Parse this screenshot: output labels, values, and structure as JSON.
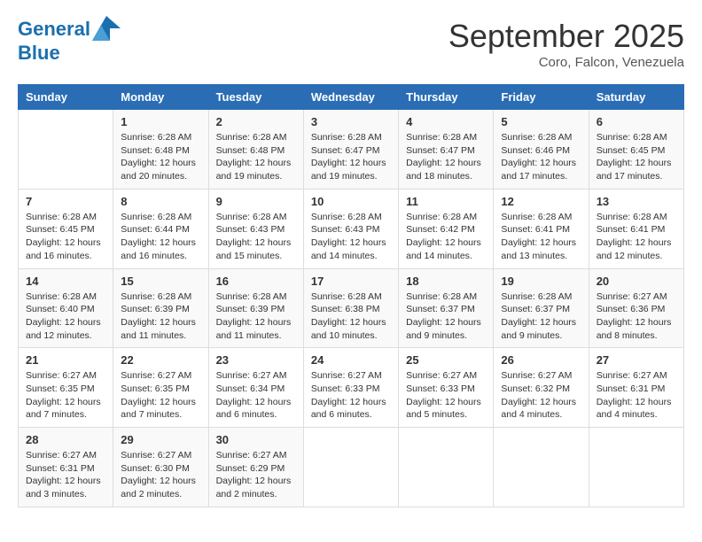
{
  "header": {
    "logo_line1": "General",
    "logo_line2": "Blue",
    "month": "September 2025",
    "location": "Coro, Falcon, Venezuela"
  },
  "columns": [
    "Sunday",
    "Monday",
    "Tuesday",
    "Wednesday",
    "Thursday",
    "Friday",
    "Saturday"
  ],
  "weeks": [
    [
      {
        "day": "",
        "text": ""
      },
      {
        "day": "1",
        "text": "Sunrise: 6:28 AM\nSunset: 6:48 PM\nDaylight: 12 hours\nand 20 minutes."
      },
      {
        "day": "2",
        "text": "Sunrise: 6:28 AM\nSunset: 6:48 PM\nDaylight: 12 hours\nand 19 minutes."
      },
      {
        "day": "3",
        "text": "Sunrise: 6:28 AM\nSunset: 6:47 PM\nDaylight: 12 hours\nand 19 minutes."
      },
      {
        "day": "4",
        "text": "Sunrise: 6:28 AM\nSunset: 6:47 PM\nDaylight: 12 hours\nand 18 minutes."
      },
      {
        "day": "5",
        "text": "Sunrise: 6:28 AM\nSunset: 6:46 PM\nDaylight: 12 hours\nand 17 minutes."
      },
      {
        "day": "6",
        "text": "Sunrise: 6:28 AM\nSunset: 6:45 PM\nDaylight: 12 hours\nand 17 minutes."
      }
    ],
    [
      {
        "day": "7",
        "text": "Sunrise: 6:28 AM\nSunset: 6:45 PM\nDaylight: 12 hours\nand 16 minutes."
      },
      {
        "day": "8",
        "text": "Sunrise: 6:28 AM\nSunset: 6:44 PM\nDaylight: 12 hours\nand 16 minutes."
      },
      {
        "day": "9",
        "text": "Sunrise: 6:28 AM\nSunset: 6:43 PM\nDaylight: 12 hours\nand 15 minutes."
      },
      {
        "day": "10",
        "text": "Sunrise: 6:28 AM\nSunset: 6:43 PM\nDaylight: 12 hours\nand 14 minutes."
      },
      {
        "day": "11",
        "text": "Sunrise: 6:28 AM\nSunset: 6:42 PM\nDaylight: 12 hours\nand 14 minutes."
      },
      {
        "day": "12",
        "text": "Sunrise: 6:28 AM\nSunset: 6:41 PM\nDaylight: 12 hours\nand 13 minutes."
      },
      {
        "day": "13",
        "text": "Sunrise: 6:28 AM\nSunset: 6:41 PM\nDaylight: 12 hours\nand 12 minutes."
      }
    ],
    [
      {
        "day": "14",
        "text": "Sunrise: 6:28 AM\nSunset: 6:40 PM\nDaylight: 12 hours\nand 12 minutes."
      },
      {
        "day": "15",
        "text": "Sunrise: 6:28 AM\nSunset: 6:39 PM\nDaylight: 12 hours\nand 11 minutes."
      },
      {
        "day": "16",
        "text": "Sunrise: 6:28 AM\nSunset: 6:39 PM\nDaylight: 12 hours\nand 11 minutes."
      },
      {
        "day": "17",
        "text": "Sunrise: 6:28 AM\nSunset: 6:38 PM\nDaylight: 12 hours\nand 10 minutes."
      },
      {
        "day": "18",
        "text": "Sunrise: 6:28 AM\nSunset: 6:37 PM\nDaylight: 12 hours\nand 9 minutes."
      },
      {
        "day": "19",
        "text": "Sunrise: 6:28 AM\nSunset: 6:37 PM\nDaylight: 12 hours\nand 9 minutes."
      },
      {
        "day": "20",
        "text": "Sunrise: 6:27 AM\nSunset: 6:36 PM\nDaylight: 12 hours\nand 8 minutes."
      }
    ],
    [
      {
        "day": "21",
        "text": "Sunrise: 6:27 AM\nSunset: 6:35 PM\nDaylight: 12 hours\nand 7 minutes."
      },
      {
        "day": "22",
        "text": "Sunrise: 6:27 AM\nSunset: 6:35 PM\nDaylight: 12 hours\nand 7 minutes."
      },
      {
        "day": "23",
        "text": "Sunrise: 6:27 AM\nSunset: 6:34 PM\nDaylight: 12 hours\nand 6 minutes."
      },
      {
        "day": "24",
        "text": "Sunrise: 6:27 AM\nSunset: 6:33 PM\nDaylight: 12 hours\nand 6 minutes."
      },
      {
        "day": "25",
        "text": "Sunrise: 6:27 AM\nSunset: 6:33 PM\nDaylight: 12 hours\nand 5 minutes."
      },
      {
        "day": "26",
        "text": "Sunrise: 6:27 AM\nSunset: 6:32 PM\nDaylight: 12 hours\nand 4 minutes."
      },
      {
        "day": "27",
        "text": "Sunrise: 6:27 AM\nSunset: 6:31 PM\nDaylight: 12 hours\nand 4 minutes."
      }
    ],
    [
      {
        "day": "28",
        "text": "Sunrise: 6:27 AM\nSunset: 6:31 PM\nDaylight: 12 hours\nand 3 minutes."
      },
      {
        "day": "29",
        "text": "Sunrise: 6:27 AM\nSunset: 6:30 PM\nDaylight: 12 hours\nand 2 minutes."
      },
      {
        "day": "30",
        "text": "Sunrise: 6:27 AM\nSunset: 6:29 PM\nDaylight: 12 hours\nand 2 minutes."
      },
      {
        "day": "",
        "text": ""
      },
      {
        "day": "",
        "text": ""
      },
      {
        "day": "",
        "text": ""
      },
      {
        "day": "",
        "text": ""
      }
    ]
  ]
}
